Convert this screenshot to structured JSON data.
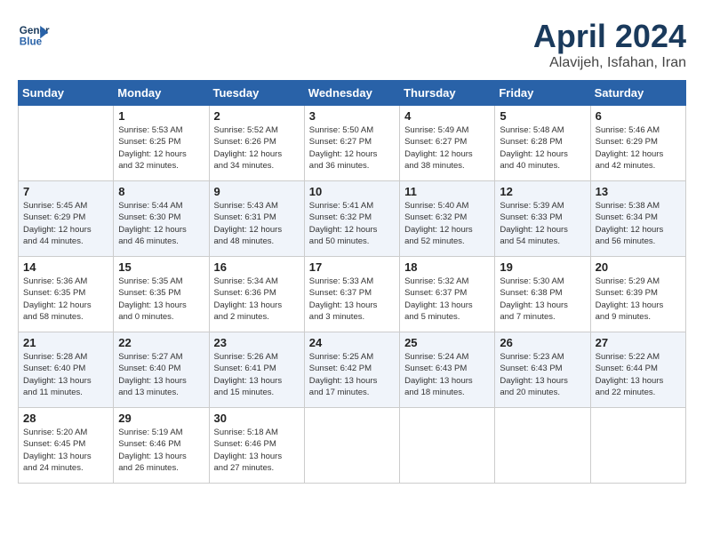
{
  "header": {
    "logo_line1": "General",
    "logo_line2": "Blue",
    "month_year": "April 2024",
    "location": "Alavijeh, Isfahan, Iran"
  },
  "days_of_week": [
    "Sunday",
    "Monday",
    "Tuesday",
    "Wednesday",
    "Thursday",
    "Friday",
    "Saturday"
  ],
  "weeks": [
    [
      {
        "day": "",
        "info": ""
      },
      {
        "day": "1",
        "info": "Sunrise: 5:53 AM\nSunset: 6:25 PM\nDaylight: 12 hours\nand 32 minutes."
      },
      {
        "day": "2",
        "info": "Sunrise: 5:52 AM\nSunset: 6:26 PM\nDaylight: 12 hours\nand 34 minutes."
      },
      {
        "day": "3",
        "info": "Sunrise: 5:50 AM\nSunset: 6:27 PM\nDaylight: 12 hours\nand 36 minutes."
      },
      {
        "day": "4",
        "info": "Sunrise: 5:49 AM\nSunset: 6:27 PM\nDaylight: 12 hours\nand 38 minutes."
      },
      {
        "day": "5",
        "info": "Sunrise: 5:48 AM\nSunset: 6:28 PM\nDaylight: 12 hours\nand 40 minutes."
      },
      {
        "day": "6",
        "info": "Sunrise: 5:46 AM\nSunset: 6:29 PM\nDaylight: 12 hours\nand 42 minutes."
      }
    ],
    [
      {
        "day": "7",
        "info": "Sunrise: 5:45 AM\nSunset: 6:29 PM\nDaylight: 12 hours\nand 44 minutes."
      },
      {
        "day": "8",
        "info": "Sunrise: 5:44 AM\nSunset: 6:30 PM\nDaylight: 12 hours\nand 46 minutes."
      },
      {
        "day": "9",
        "info": "Sunrise: 5:43 AM\nSunset: 6:31 PM\nDaylight: 12 hours\nand 48 minutes."
      },
      {
        "day": "10",
        "info": "Sunrise: 5:41 AM\nSunset: 6:32 PM\nDaylight: 12 hours\nand 50 minutes."
      },
      {
        "day": "11",
        "info": "Sunrise: 5:40 AM\nSunset: 6:32 PM\nDaylight: 12 hours\nand 52 minutes."
      },
      {
        "day": "12",
        "info": "Sunrise: 5:39 AM\nSunset: 6:33 PM\nDaylight: 12 hours\nand 54 minutes."
      },
      {
        "day": "13",
        "info": "Sunrise: 5:38 AM\nSunset: 6:34 PM\nDaylight: 12 hours\nand 56 minutes."
      }
    ],
    [
      {
        "day": "14",
        "info": "Sunrise: 5:36 AM\nSunset: 6:35 PM\nDaylight: 12 hours\nand 58 minutes."
      },
      {
        "day": "15",
        "info": "Sunrise: 5:35 AM\nSunset: 6:35 PM\nDaylight: 13 hours\nand 0 minutes."
      },
      {
        "day": "16",
        "info": "Sunrise: 5:34 AM\nSunset: 6:36 PM\nDaylight: 13 hours\nand 2 minutes."
      },
      {
        "day": "17",
        "info": "Sunrise: 5:33 AM\nSunset: 6:37 PM\nDaylight: 13 hours\nand 3 minutes."
      },
      {
        "day": "18",
        "info": "Sunrise: 5:32 AM\nSunset: 6:37 PM\nDaylight: 13 hours\nand 5 minutes."
      },
      {
        "day": "19",
        "info": "Sunrise: 5:30 AM\nSunset: 6:38 PM\nDaylight: 13 hours\nand 7 minutes."
      },
      {
        "day": "20",
        "info": "Sunrise: 5:29 AM\nSunset: 6:39 PM\nDaylight: 13 hours\nand 9 minutes."
      }
    ],
    [
      {
        "day": "21",
        "info": "Sunrise: 5:28 AM\nSunset: 6:40 PM\nDaylight: 13 hours\nand 11 minutes."
      },
      {
        "day": "22",
        "info": "Sunrise: 5:27 AM\nSunset: 6:40 PM\nDaylight: 13 hours\nand 13 minutes."
      },
      {
        "day": "23",
        "info": "Sunrise: 5:26 AM\nSunset: 6:41 PM\nDaylight: 13 hours\nand 15 minutes."
      },
      {
        "day": "24",
        "info": "Sunrise: 5:25 AM\nSunset: 6:42 PM\nDaylight: 13 hours\nand 17 minutes."
      },
      {
        "day": "25",
        "info": "Sunrise: 5:24 AM\nSunset: 6:43 PM\nDaylight: 13 hours\nand 18 minutes."
      },
      {
        "day": "26",
        "info": "Sunrise: 5:23 AM\nSunset: 6:43 PM\nDaylight: 13 hours\nand 20 minutes."
      },
      {
        "day": "27",
        "info": "Sunrise: 5:22 AM\nSunset: 6:44 PM\nDaylight: 13 hours\nand 22 minutes."
      }
    ],
    [
      {
        "day": "28",
        "info": "Sunrise: 5:20 AM\nSunset: 6:45 PM\nDaylight: 13 hours\nand 24 minutes."
      },
      {
        "day": "29",
        "info": "Sunrise: 5:19 AM\nSunset: 6:46 PM\nDaylight: 13 hours\nand 26 minutes."
      },
      {
        "day": "30",
        "info": "Sunrise: 5:18 AM\nSunset: 6:46 PM\nDaylight: 13 hours\nand 27 minutes."
      },
      {
        "day": "",
        "info": ""
      },
      {
        "day": "",
        "info": ""
      },
      {
        "day": "",
        "info": ""
      },
      {
        "day": "",
        "info": ""
      }
    ]
  ]
}
